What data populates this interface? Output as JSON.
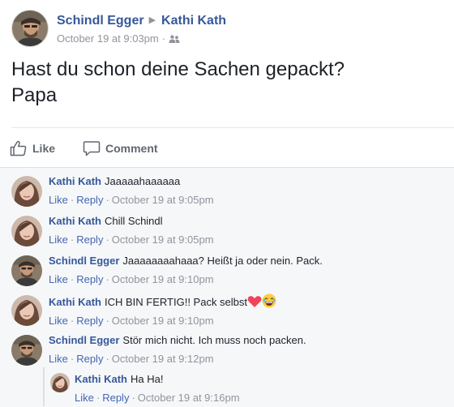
{
  "post": {
    "author": "Schindl Egger",
    "target": "Kathi Kath",
    "timestamp": "October 19 at 9:03pm",
    "audience_icon": "friends-icon",
    "text_line1": "Hast du schon deine Sachen gepackt?",
    "text_line2": "Papa"
  },
  "actions": {
    "like_label": "Like",
    "comment_label": "Comment"
  },
  "colors": {
    "link_blue": "#365899",
    "meta_gray": "#90949c",
    "comment_bg": "#f6f7f9"
  },
  "comments": [
    {
      "author": "Kathi Kath",
      "text": "Jaaaaahaaaaaa",
      "like": "Like",
      "reply": "Reply",
      "time": "October 19 at 9:05pm"
    },
    {
      "author": "Kathi Kath",
      "text": "Chill Schindl",
      "like": "Like",
      "reply": "Reply",
      "time": "October 19 at 9:05pm"
    },
    {
      "author": "Schindl Egger",
      "text": "Jaaaaaaaahaaa? Heißt ja oder nein. Pack.",
      "like": "Like",
      "reply": "Reply",
      "time": "October 19 at 9:10pm"
    },
    {
      "author": "Kathi Kath",
      "text": "ICH BIN FERTIG!! Pack selbst",
      "emojis": [
        "heart-emoji",
        "laughing-emoji"
      ],
      "like": "Like",
      "reply": "Reply",
      "time": "October 19 at 9:10pm"
    },
    {
      "author": "Schindl Egger",
      "text": "Stör mich nicht. Ich muss noch packen.",
      "like": "Like",
      "reply": "Reply",
      "time": "October 19 at 9:12pm"
    }
  ],
  "reply": {
    "author": "Kathi Kath",
    "text": "Ha Ha!",
    "like": "Like",
    "reply": "Reply",
    "time": "October 19 at 9:16pm"
  },
  "separator": "·"
}
